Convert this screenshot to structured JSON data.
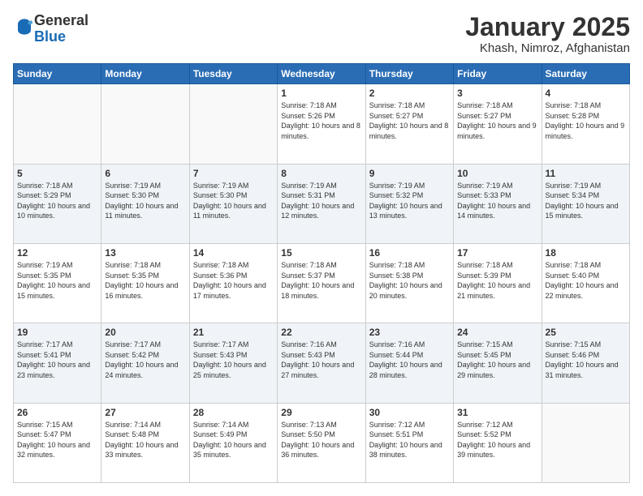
{
  "header": {
    "logo_general": "General",
    "logo_blue": "Blue",
    "month_title": "January 2025",
    "location": "Khash, Nimroz, Afghanistan"
  },
  "days_of_week": [
    "Sunday",
    "Monday",
    "Tuesday",
    "Wednesday",
    "Thursday",
    "Friday",
    "Saturday"
  ],
  "weeks": [
    [
      {
        "day": "",
        "sunrise": "",
        "sunset": "",
        "daylight": "",
        "empty": true
      },
      {
        "day": "",
        "sunrise": "",
        "sunset": "",
        "daylight": "",
        "empty": true
      },
      {
        "day": "",
        "sunrise": "",
        "sunset": "",
        "daylight": "",
        "empty": true
      },
      {
        "day": "1",
        "sunrise": "Sunrise: 7:18 AM",
        "sunset": "Sunset: 5:26 PM",
        "daylight": "Daylight: 10 hours and 8 minutes.",
        "empty": false
      },
      {
        "day": "2",
        "sunrise": "Sunrise: 7:18 AM",
        "sunset": "Sunset: 5:27 PM",
        "daylight": "Daylight: 10 hours and 8 minutes.",
        "empty": false
      },
      {
        "day": "3",
        "sunrise": "Sunrise: 7:18 AM",
        "sunset": "Sunset: 5:27 PM",
        "daylight": "Daylight: 10 hours and 9 minutes.",
        "empty": false
      },
      {
        "day": "4",
        "sunrise": "Sunrise: 7:18 AM",
        "sunset": "Sunset: 5:28 PM",
        "daylight": "Daylight: 10 hours and 9 minutes.",
        "empty": false
      }
    ],
    [
      {
        "day": "5",
        "sunrise": "Sunrise: 7:18 AM",
        "sunset": "Sunset: 5:29 PM",
        "daylight": "Daylight: 10 hours and 10 minutes.",
        "empty": false
      },
      {
        "day": "6",
        "sunrise": "Sunrise: 7:19 AM",
        "sunset": "Sunset: 5:30 PM",
        "daylight": "Daylight: 10 hours and 11 minutes.",
        "empty": false
      },
      {
        "day": "7",
        "sunrise": "Sunrise: 7:19 AM",
        "sunset": "Sunset: 5:30 PM",
        "daylight": "Daylight: 10 hours and 11 minutes.",
        "empty": false
      },
      {
        "day": "8",
        "sunrise": "Sunrise: 7:19 AM",
        "sunset": "Sunset: 5:31 PM",
        "daylight": "Daylight: 10 hours and 12 minutes.",
        "empty": false
      },
      {
        "day": "9",
        "sunrise": "Sunrise: 7:19 AM",
        "sunset": "Sunset: 5:32 PM",
        "daylight": "Daylight: 10 hours and 13 minutes.",
        "empty": false
      },
      {
        "day": "10",
        "sunrise": "Sunrise: 7:19 AM",
        "sunset": "Sunset: 5:33 PM",
        "daylight": "Daylight: 10 hours and 14 minutes.",
        "empty": false
      },
      {
        "day": "11",
        "sunrise": "Sunrise: 7:19 AM",
        "sunset": "Sunset: 5:34 PM",
        "daylight": "Daylight: 10 hours and 15 minutes.",
        "empty": false
      }
    ],
    [
      {
        "day": "12",
        "sunrise": "Sunrise: 7:19 AM",
        "sunset": "Sunset: 5:35 PM",
        "daylight": "Daylight: 10 hours and 15 minutes.",
        "empty": false
      },
      {
        "day": "13",
        "sunrise": "Sunrise: 7:18 AM",
        "sunset": "Sunset: 5:35 PM",
        "daylight": "Daylight: 10 hours and 16 minutes.",
        "empty": false
      },
      {
        "day": "14",
        "sunrise": "Sunrise: 7:18 AM",
        "sunset": "Sunset: 5:36 PM",
        "daylight": "Daylight: 10 hours and 17 minutes.",
        "empty": false
      },
      {
        "day": "15",
        "sunrise": "Sunrise: 7:18 AM",
        "sunset": "Sunset: 5:37 PM",
        "daylight": "Daylight: 10 hours and 18 minutes.",
        "empty": false
      },
      {
        "day": "16",
        "sunrise": "Sunrise: 7:18 AM",
        "sunset": "Sunset: 5:38 PM",
        "daylight": "Daylight: 10 hours and 20 minutes.",
        "empty": false
      },
      {
        "day": "17",
        "sunrise": "Sunrise: 7:18 AM",
        "sunset": "Sunset: 5:39 PM",
        "daylight": "Daylight: 10 hours and 21 minutes.",
        "empty": false
      },
      {
        "day": "18",
        "sunrise": "Sunrise: 7:18 AM",
        "sunset": "Sunset: 5:40 PM",
        "daylight": "Daylight: 10 hours and 22 minutes.",
        "empty": false
      }
    ],
    [
      {
        "day": "19",
        "sunrise": "Sunrise: 7:17 AM",
        "sunset": "Sunset: 5:41 PM",
        "daylight": "Daylight: 10 hours and 23 minutes.",
        "empty": false
      },
      {
        "day": "20",
        "sunrise": "Sunrise: 7:17 AM",
        "sunset": "Sunset: 5:42 PM",
        "daylight": "Daylight: 10 hours and 24 minutes.",
        "empty": false
      },
      {
        "day": "21",
        "sunrise": "Sunrise: 7:17 AM",
        "sunset": "Sunset: 5:43 PM",
        "daylight": "Daylight: 10 hours and 25 minutes.",
        "empty": false
      },
      {
        "day": "22",
        "sunrise": "Sunrise: 7:16 AM",
        "sunset": "Sunset: 5:43 PM",
        "daylight": "Daylight: 10 hours and 27 minutes.",
        "empty": false
      },
      {
        "day": "23",
        "sunrise": "Sunrise: 7:16 AM",
        "sunset": "Sunset: 5:44 PM",
        "daylight": "Daylight: 10 hours and 28 minutes.",
        "empty": false
      },
      {
        "day": "24",
        "sunrise": "Sunrise: 7:15 AM",
        "sunset": "Sunset: 5:45 PM",
        "daylight": "Daylight: 10 hours and 29 minutes.",
        "empty": false
      },
      {
        "day": "25",
        "sunrise": "Sunrise: 7:15 AM",
        "sunset": "Sunset: 5:46 PM",
        "daylight": "Daylight: 10 hours and 31 minutes.",
        "empty": false
      }
    ],
    [
      {
        "day": "26",
        "sunrise": "Sunrise: 7:15 AM",
        "sunset": "Sunset: 5:47 PM",
        "daylight": "Daylight: 10 hours and 32 minutes.",
        "empty": false
      },
      {
        "day": "27",
        "sunrise": "Sunrise: 7:14 AM",
        "sunset": "Sunset: 5:48 PM",
        "daylight": "Daylight: 10 hours and 33 minutes.",
        "empty": false
      },
      {
        "day": "28",
        "sunrise": "Sunrise: 7:14 AM",
        "sunset": "Sunset: 5:49 PM",
        "daylight": "Daylight: 10 hours and 35 minutes.",
        "empty": false
      },
      {
        "day": "29",
        "sunrise": "Sunrise: 7:13 AM",
        "sunset": "Sunset: 5:50 PM",
        "daylight": "Daylight: 10 hours and 36 minutes.",
        "empty": false
      },
      {
        "day": "30",
        "sunrise": "Sunrise: 7:12 AM",
        "sunset": "Sunset: 5:51 PM",
        "daylight": "Daylight: 10 hours and 38 minutes.",
        "empty": false
      },
      {
        "day": "31",
        "sunrise": "Sunrise: 7:12 AM",
        "sunset": "Sunset: 5:52 PM",
        "daylight": "Daylight: 10 hours and 39 minutes.",
        "empty": false
      },
      {
        "day": "",
        "sunrise": "",
        "sunset": "",
        "daylight": "",
        "empty": true
      }
    ]
  ]
}
